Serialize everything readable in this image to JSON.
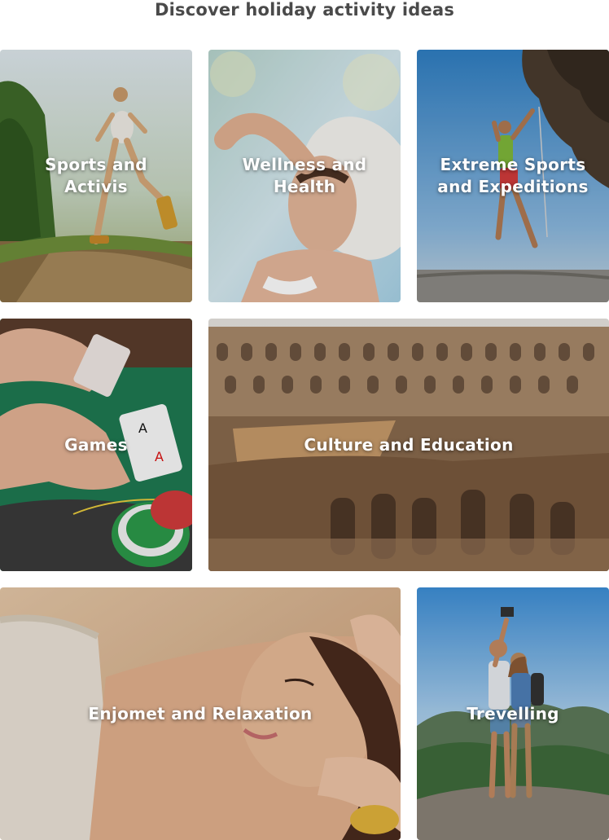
{
  "page": {
    "title": "Discover holiday activity ideas"
  },
  "tiles": [
    {
      "label": "Sports and\nActivis",
      "image": "woman-running-trail-photo"
    },
    {
      "label": "Wellness and\nHealth",
      "image": "woman-sunhat-relaxing-photo"
    },
    {
      "label": "Extreme Sports\nand Expeditions",
      "image": "rock-climber-cliff-photo"
    },
    {
      "label": "Games",
      "image": "poker-cards-chips-photo"
    },
    {
      "label": "Culture and Education",
      "image": "colosseum-interior-photo"
    },
    {
      "label": "Enjomet and Relaxation",
      "image": "woman-head-massage-photo"
    },
    {
      "label": "Trevelling",
      "image": "couple-selfie-mountain-photo"
    }
  ]
}
